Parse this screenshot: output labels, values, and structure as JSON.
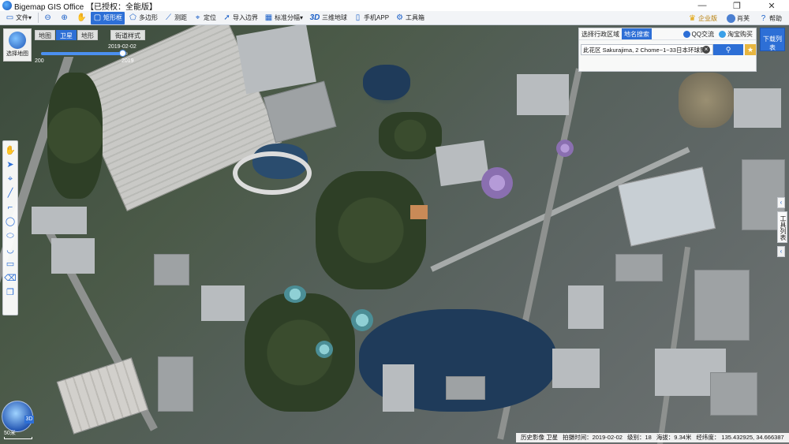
{
  "window": {
    "title": "Bigemap GIS Office 【已授权：全能版】",
    "controls": {
      "minimize": "—",
      "maximize": "❐",
      "close": "✕"
    }
  },
  "toolbar": {
    "items": [
      {
        "label": "文件",
        "icon": "folder-icon",
        "glyph": "▭"
      },
      {
        "label": "",
        "icon": "zoom-out-icon",
        "glyph": "⊖"
      },
      {
        "label": "",
        "icon": "zoom-in-icon",
        "glyph": "⊕"
      },
      {
        "label": "",
        "icon": "hand-pan-icon",
        "glyph": "✋"
      },
      {
        "label": "矩形框",
        "icon": "rectangle-select-icon",
        "glyph": "▢",
        "active": true
      },
      {
        "label": "多边形",
        "icon": "polygon-icon",
        "glyph": "⬠"
      },
      {
        "label": "测距",
        "icon": "ruler-icon",
        "glyph": "📏"
      },
      {
        "label": "定位",
        "icon": "location-pin-icon",
        "glyph": "⌖"
      },
      {
        "label": "导入边界",
        "icon": "import-boundary-icon",
        "glyph": "➚"
      },
      {
        "label": "标准分幅",
        "icon": "grid-icon",
        "glyph": "▦"
      },
      {
        "label": "三维地球",
        "icon": "3d-icon",
        "glyph": "3D"
      },
      {
        "label": "手机APP",
        "icon": "phone-icon",
        "glyph": "▯"
      },
      {
        "label": "工具箱",
        "icon": "gear-icon",
        "glyph": "⚙"
      }
    ],
    "right": {
      "enterprise": "企业版",
      "user": "肖芙",
      "help": "帮助"
    }
  },
  "map": {
    "tabs": [
      "地图",
      "卫星",
      "地形"
    ],
    "selected_tab": "卫星",
    "street_style": "街道样式",
    "select_map_label": "选择地图",
    "timeline": {
      "current": "2019-02-02",
      "start_year": "200",
      "end_year": "2019",
      "progress": 0.94
    }
  },
  "search_panel": {
    "tabs": [
      "选择行政区域",
      "地名搜索"
    ],
    "selected_tab": "地名搜索",
    "links": [
      "QQ交流",
      "淘宝购买"
    ],
    "query": "此花区 Sakurajima, 2 Chome−1−33日本环球影城",
    "search_icon": "search-icon",
    "fav_icon": "star-icon"
  },
  "download_list": "下载列表",
  "tool_list": "工具列表",
  "mini_globe_label": "3D",
  "scale_label": "50米",
  "status": {
    "layer": "历史影像 卫星",
    "shot_time": "拍摄时间：2019-02-02",
    "level": "级别：18",
    "altitude": "海拔：9.34米",
    "coords_label": "经纬度：",
    "coords": "135.432925, 34.666387"
  },
  "left_rail": [
    {
      "icon": "hand-icon",
      "glyph": "✋"
    },
    {
      "icon": "pointer-icon",
      "glyph": "➤"
    },
    {
      "icon": "pin-icon",
      "glyph": "⌖"
    },
    {
      "icon": "line-icon",
      "glyph": "╱"
    },
    {
      "icon": "polyline-icon",
      "glyph": "⌐"
    },
    {
      "icon": "circle-icon",
      "glyph": "◯"
    },
    {
      "icon": "ellipse-icon",
      "glyph": "⬭"
    },
    {
      "icon": "arc-icon",
      "glyph": "◡"
    },
    {
      "icon": "rectangle-icon",
      "glyph": "▭"
    },
    {
      "icon": "eraser-icon",
      "glyph": "⌫"
    },
    {
      "icon": "copy-icon",
      "glyph": "❐"
    }
  ]
}
